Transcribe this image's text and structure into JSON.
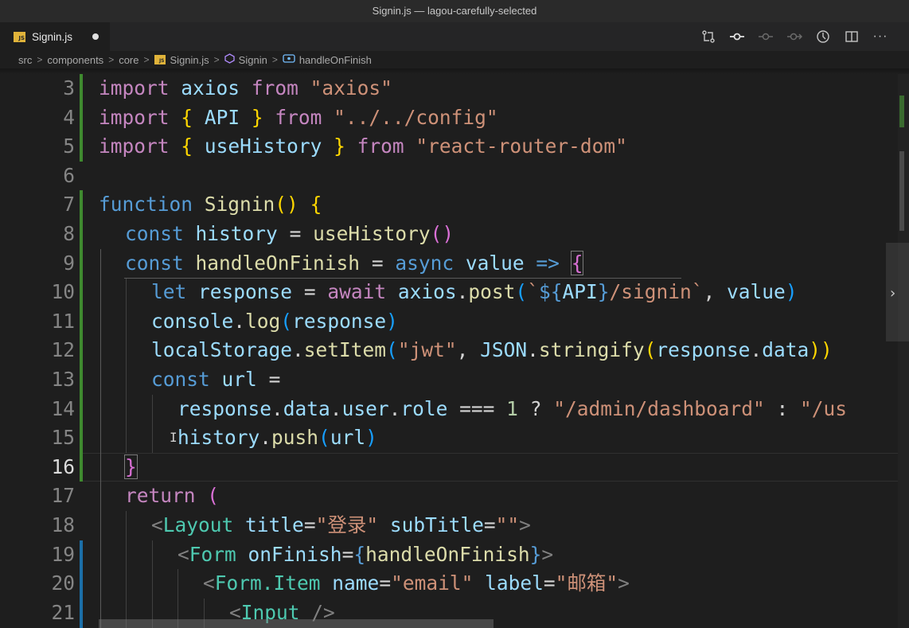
{
  "window": {
    "title": "Signin.js — lagou-carefully-selected"
  },
  "tab": {
    "badge": "JS",
    "label": "Signin.js"
  },
  "breadcrumb": {
    "items": [
      "src",
      "components",
      "core",
      "Signin.js",
      "Signin",
      "handleOnFinish"
    ],
    "separator": ">"
  },
  "editor": {
    "line_numbers": [
      "3",
      "4",
      "5",
      "6",
      "7",
      "8",
      "9",
      "10",
      "11",
      "12",
      "13",
      "14",
      "15",
      "16",
      "17",
      "18",
      "19",
      "20",
      "21"
    ],
    "active_line": "16",
    "code": {
      "l3": [
        "import",
        "axios",
        "from",
        "\"axios\""
      ],
      "l4": [
        "import",
        "{",
        "API",
        "}",
        "from",
        "\"../../config\""
      ],
      "l5": [
        "import",
        "{",
        "useHistory",
        "}",
        "from",
        "\"react-router-dom\""
      ],
      "l7": [
        "function",
        "Signin",
        "()",
        "{"
      ],
      "l8": [
        "const",
        "history",
        "=",
        "useHistory",
        "()"
      ],
      "l9": [
        "const",
        "handleOnFinish",
        "=",
        "async",
        "value",
        "=>",
        "{"
      ],
      "l10": [
        "let",
        "response",
        "=",
        "await",
        "axios",
        ".",
        "post",
        "(",
        "`",
        "${",
        "API",
        "}",
        "/signin`",
        ",",
        "value",
        ")"
      ],
      "l11": [
        "console",
        ".",
        "log",
        "(",
        "response",
        ")"
      ],
      "l12": [
        "localStorage",
        ".",
        "setItem",
        "(",
        "\"jwt\"",
        ",",
        "JSON",
        ".",
        "stringify",
        "(",
        "response",
        ".",
        "data",
        "))"
      ],
      "l13": [
        "const",
        "url",
        "="
      ],
      "l14": [
        "response",
        ".",
        "data",
        ".",
        "user",
        ".",
        "role",
        "===",
        "1",
        "?",
        "\"/admin/dashboard\"",
        ":",
        "\"/us"
      ],
      "l15": [
        "history",
        ".",
        "push",
        "(",
        "url",
        ")"
      ],
      "l16": [
        "}"
      ],
      "l17": [
        "return",
        "("
      ],
      "l18": [
        "<",
        "Layout",
        "title",
        "=",
        "\"登录\"",
        "subTitle",
        "=",
        "\"\"",
        ">"
      ],
      "l19": [
        "<",
        "Form",
        "onFinish",
        "=",
        "{",
        "handleOnFinish",
        "}",
        ">"
      ],
      "l20": [
        "<",
        "Form.Item",
        "name",
        "=",
        "\"email\"",
        "label",
        "=",
        "\"邮箱\"",
        ">"
      ],
      "l21": [
        "<",
        "Input",
        "/>"
      ]
    }
  },
  "icons": [
    "compare-changes-icon",
    "git-commit-icon",
    "previous-change-icon",
    "next-change-icon",
    "timeline-icon",
    "split-editor-icon",
    "more-actions-icon",
    "symbol-class-icon",
    "symbol-method-icon",
    "peek-chevron-icon"
  ],
  "colors": {
    "keyword": "#c586c0",
    "storage": "#569cd6",
    "function": "#dcdcaa",
    "variable": "#9cdcfe",
    "string": "#ce9178",
    "number": "#b5cea8",
    "git_added": "#3f8a2f",
    "git_modified": "#1b6fa8"
  },
  "controls": {
    "more": "···",
    "chevron": "›"
  }
}
